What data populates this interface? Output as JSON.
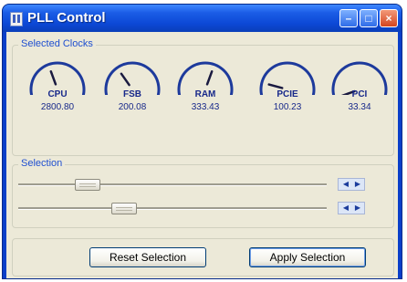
{
  "window": {
    "title": "PLL Control"
  },
  "title_buttons": {
    "minimize": "–",
    "maximize": "□",
    "close": "×"
  },
  "clocks_group": {
    "label": "Selected Clocks"
  },
  "gauges": [
    {
      "name": "CPU",
      "value": "2800.80",
      "needle_angle": -20
    },
    {
      "name": "FSB",
      "value": "200.08",
      "needle_angle": -35
    },
    {
      "name": "RAM",
      "value": "333.43",
      "needle_angle": 20
    },
    {
      "name": "PCIE",
      "value": "100.23",
      "needle_angle": -75
    },
    {
      "name": "PCI",
      "value": "33.34",
      "needle_angle": -110
    }
  ],
  "selection_group": {
    "label": "Selection"
  },
  "sliders": [
    {
      "name": "selection-slider-1",
      "level_percent": 20
    },
    {
      "name": "selection-slider-2",
      "level_percent": 33
    }
  ],
  "spinner": {
    "left_glyph": "◀",
    "right_glyph": "▶"
  },
  "buttons": {
    "reset": "Reset Selection",
    "apply": "Apply Selection"
  },
  "colors": {
    "title_bar": "#0c48d6",
    "gauge": "#1d3a9c",
    "label": "#1f4fd0",
    "face": "#ece9d8"
  }
}
